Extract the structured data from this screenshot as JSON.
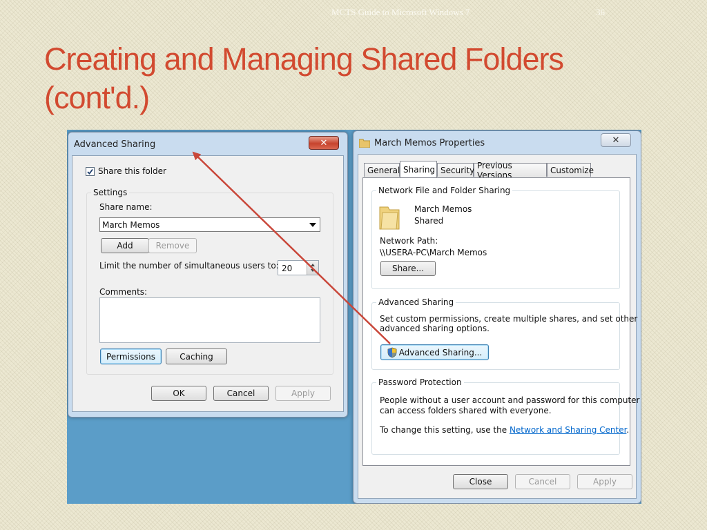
{
  "slide": {
    "header": "MCTS Guide to Microsoft Windows 7",
    "page_number": "36",
    "title_line1": "Creating and Managing Shared Folders",
    "title_line2": "(cont'd.)"
  },
  "advanced_sharing_dialog": {
    "title": "Advanced Sharing",
    "close_glyph": "✕",
    "share_checkbox_label": "Share this folder",
    "share_checked": true,
    "settings_group_label": "Settings",
    "share_name_label": "Share name:",
    "share_name_value": "March Memos",
    "add_label": "Add",
    "remove_label": "Remove",
    "limit_label": "Limit the number of simultaneous users to:",
    "limit_value": "20",
    "comments_label": "Comments:",
    "comments_value": "",
    "permissions_label": "Permissions",
    "caching_label": "Caching",
    "ok_label": "OK",
    "cancel_label": "Cancel",
    "apply_label": "Apply"
  },
  "properties_dialog": {
    "title": "March Memos Properties",
    "close_glyph": "✕",
    "tabs": [
      "General",
      "Sharing",
      "Security",
      "Previous Versions",
      "Customize"
    ],
    "active_tab": "Sharing",
    "network_group_label": "Network File and Folder Sharing",
    "folder_name": "March Memos",
    "folder_status": "Shared",
    "network_path_label": "Network Path:",
    "network_path_value": "\\\\USERA-PC\\March Memos",
    "share_button_label": "Share...",
    "advanced_group_label": "Advanced Sharing",
    "advanced_desc_line1": "Set custom permissions, create multiple shares, and set other",
    "advanced_desc_line2": "advanced sharing options.",
    "advanced_button_label": "Advanced Sharing...",
    "password_group_label": "Password Protection",
    "password_desc_line1": "People without a user account and password for this computer",
    "password_desc_line2": "can access folders shared with everyone.",
    "change_setting_prefix": "To change this setting, use the ",
    "change_setting_link": "Network and Sharing Center",
    "change_setting_suffix": ".",
    "close_label": "Close",
    "cancel_label": "Cancel",
    "apply_label": "Apply"
  },
  "colors": {
    "title": "#d24a30",
    "desktop": "#5b9dc8",
    "arrow": "#c9473a",
    "link": "#0066cc"
  },
  "icons": {
    "folder": "folder-icon",
    "shield": "uac-shield-icon",
    "dropdown": "chevron-down-icon",
    "spinner": "spinner-arrows-icon"
  }
}
